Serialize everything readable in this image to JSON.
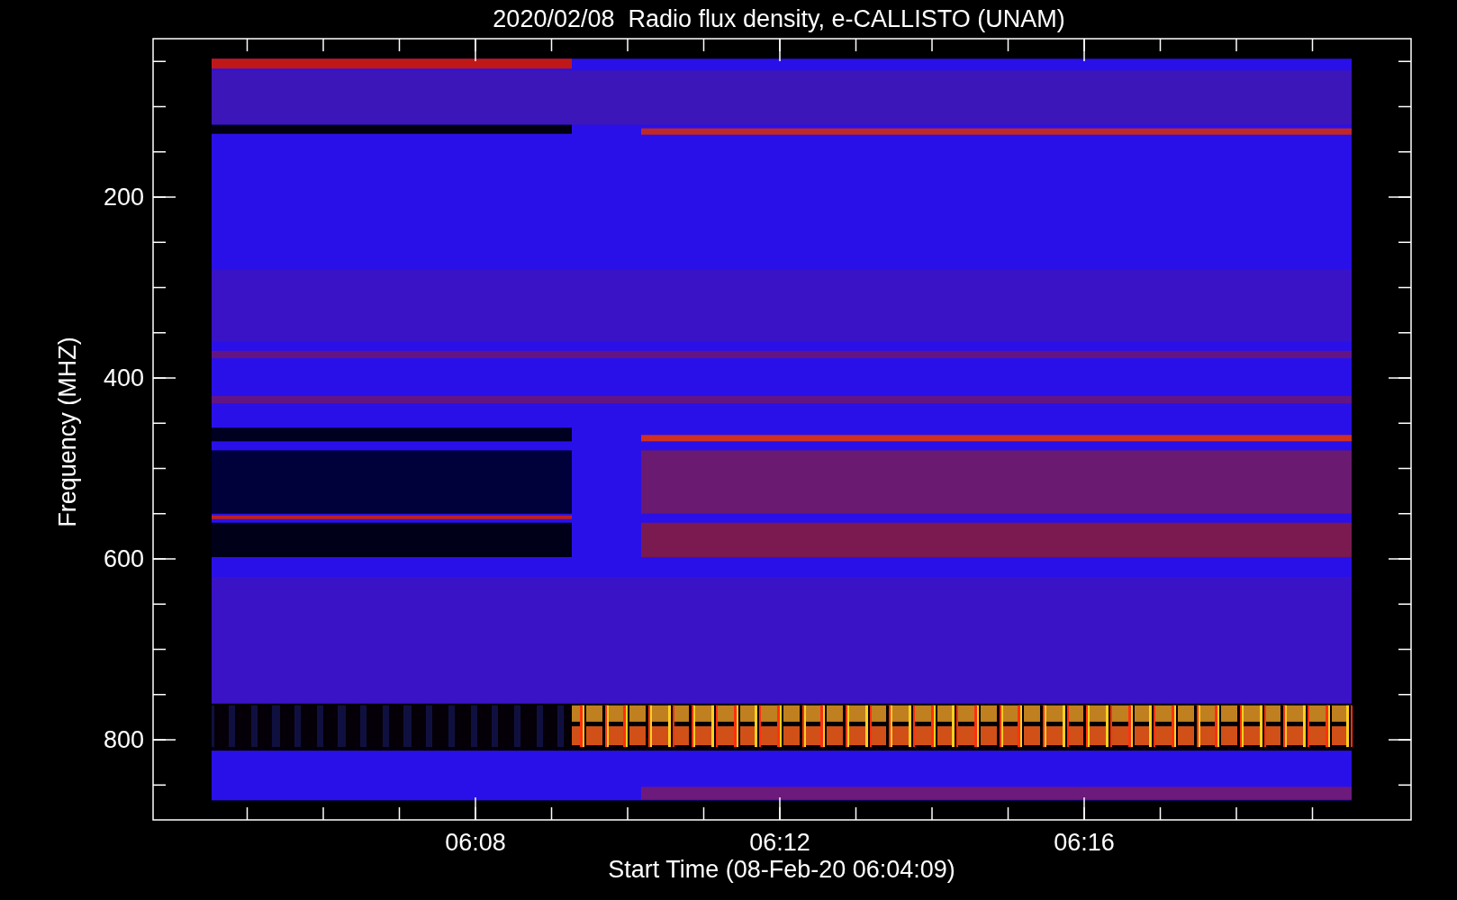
{
  "title": "2020/02/08  Radio flux density, e-CALLISTO (UNAM)",
  "ylabel": "Frequency (MHZ)",
  "xlabel": "Start Time (08-Feb-20 06:04:09)",
  "yticks": [
    "200",
    "400",
    "600",
    "800"
  ],
  "xticks": [
    "06:08",
    "06:12",
    "06:16"
  ]
}
